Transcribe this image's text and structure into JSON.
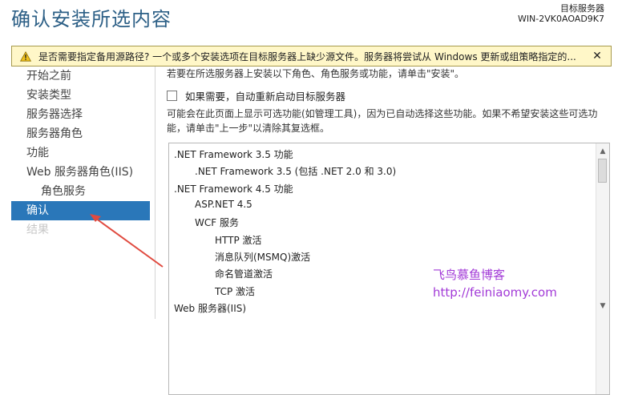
{
  "header": {
    "title": "确认安装所选内容",
    "server_label": "目标服务器",
    "server_name": "WIN-2VK0AOAD9K7"
  },
  "warning": {
    "text": "是否需要指定备用源路径? 一个或多个安装选项在目标服务器上缺少源文件。服务器将尝试从 Windows 更新或组策略指定的...",
    "close": "✕"
  },
  "sidebar": {
    "items": [
      {
        "label": "开始之前"
      },
      {
        "label": "安装类型"
      },
      {
        "label": "服务器选择"
      },
      {
        "label": "服务器角色"
      },
      {
        "label": "功能"
      },
      {
        "label": "Web 服务器角色(IIS)"
      },
      {
        "label": "角色服务"
      },
      {
        "label": "确认"
      },
      {
        "label": "结果"
      }
    ]
  },
  "main": {
    "intro": "若要在所选服务器上安装以下角色、角色服务或功能，请单击\"安装\"。",
    "restart_label": "如果需要，自动重新启动目标服务器",
    "description": "可能会在此页面上显示可选功能(如管理工具)，因为已自动选择这些功能。如果不希望安装这些可选功能，请单击\"上一步\"以清除其复选框。",
    "features": [
      ".NET Framework 3.5 功能",
      ".NET Framework 3.5 (包括 .NET 2.0 和 3.0)",
      ".NET Framework 4.5 功能",
      "ASP.NET 4.5",
      "WCF 服务",
      "HTTP 激活",
      "消息队列(MSMQ)激活",
      "命名管道激活",
      "TCP 激活",
      "Web 服务器(IIS)"
    ]
  },
  "watermark": {
    "line1": "飞鸟慕鱼博客",
    "line2": "http://feiniaomy.com"
  },
  "colors": {
    "title": "#2c5f86",
    "active_nav": "#2a77b9",
    "warning_bg": "#fff7c8",
    "watermark": "#a23ad7",
    "arrow": "#e04a3f"
  }
}
